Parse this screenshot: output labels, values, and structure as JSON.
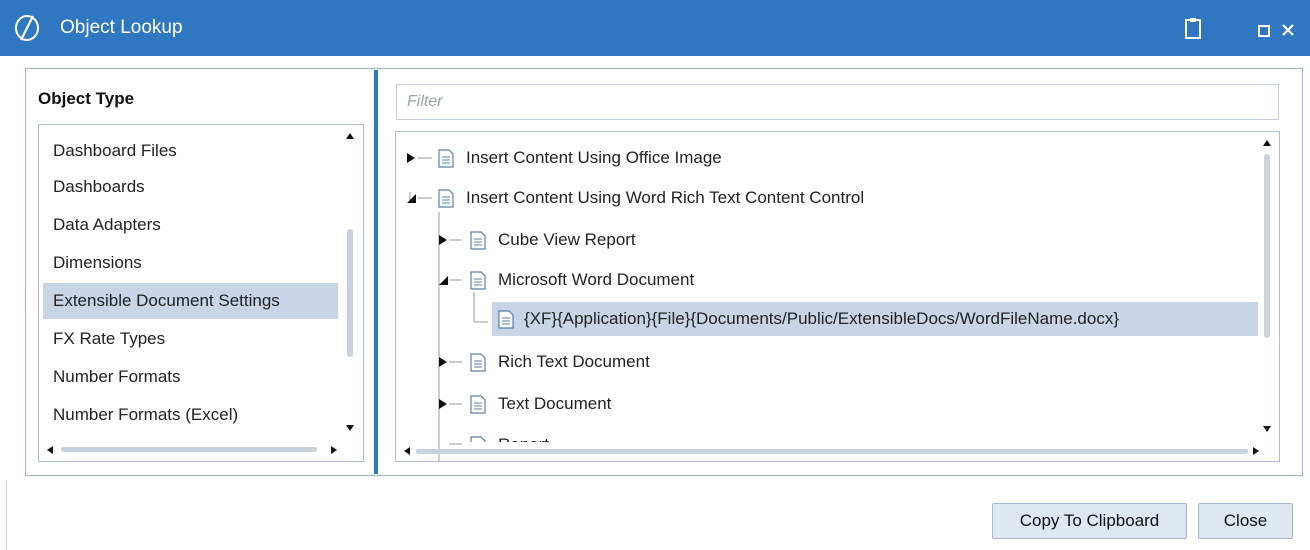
{
  "window": {
    "title": "Object Lookup",
    "accent_color": "#2f77c0",
    "selection_color": "#c8d5e7",
    "icons": [
      "app-logo-icon",
      "clipboard-icon",
      "maximize-icon",
      "close-icon"
    ]
  },
  "left_panel": {
    "heading": "Object Type",
    "items": [
      {
        "label": "Dashboard Files",
        "selected": false
      },
      {
        "label": "Dashboards",
        "selected": false
      },
      {
        "label": "Data Adapters",
        "selected": false
      },
      {
        "label": "Dimensions",
        "selected": false
      },
      {
        "label": "Extensible Document Settings",
        "selected": true
      },
      {
        "label": "FX Rate Types",
        "selected": false
      },
      {
        "label": "Number Formats",
        "selected": false
      },
      {
        "label": "Number Formats (Excel)",
        "selected": false
      }
    ]
  },
  "filter": {
    "placeholder": "Filter",
    "value": ""
  },
  "tree": {
    "rows": [
      {
        "label": "Insert Content Using Office Image",
        "level": 0,
        "state": "collapsed",
        "selected": false
      },
      {
        "label": "Insert Content Using Word Rich Text Content Control",
        "level": 0,
        "state": "expanded",
        "selected": false
      },
      {
        "label": "Cube View Report",
        "level": 1,
        "state": "collapsed",
        "selected": false
      },
      {
        "label": "Microsoft Word Document",
        "level": 1,
        "state": "expanded",
        "selected": false
      },
      {
        "label": "{XF}{Application}{File}{Documents/Public/ExtensibleDocs/WordFileName.docx}",
        "level": 2,
        "state": "leaf",
        "selected": true
      },
      {
        "label": "Rich Text Document",
        "level": 1,
        "state": "collapsed",
        "selected": false
      },
      {
        "label": "Text Document",
        "level": 1,
        "state": "collapsed",
        "selected": false
      },
      {
        "label": "Report",
        "level": 1,
        "state": "collapsed",
        "selected": false
      }
    ]
  },
  "buttons": {
    "copy": "Copy To Clipboard",
    "close": "Close"
  }
}
